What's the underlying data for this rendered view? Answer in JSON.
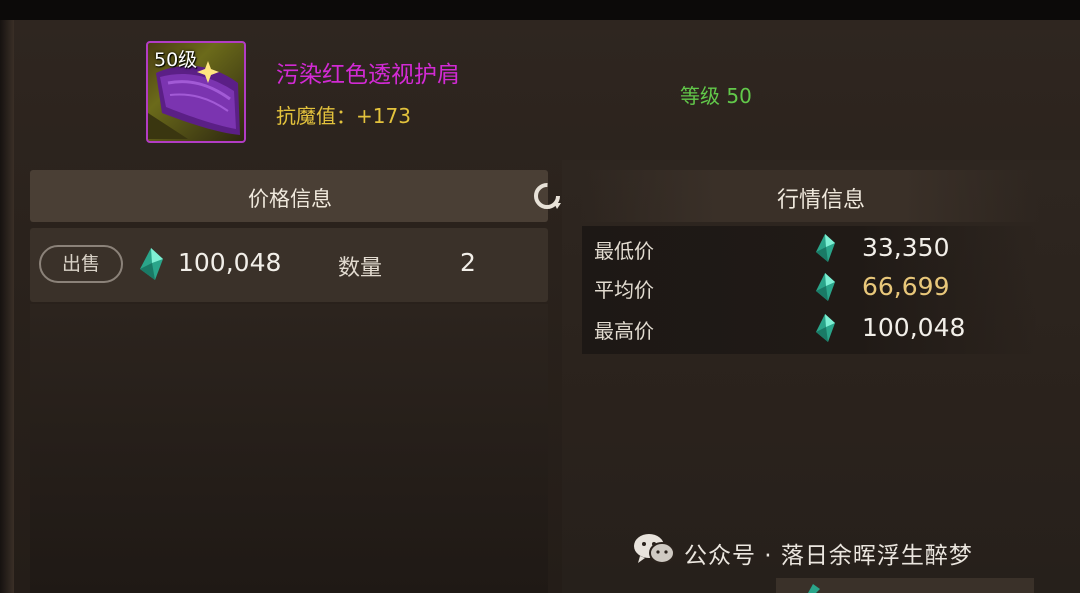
{
  "item": {
    "level_badge": "50级",
    "name": "污染红色透视护肩",
    "stat": "抗魔值：+173",
    "grade": "等级 50",
    "icon": "purple-shoulder-armor-icon"
  },
  "price_panel": {
    "title": "价格信息",
    "refresh_icon": "refresh-icon",
    "listing": {
      "sell_label": "出售",
      "currency_icon": "crystal-gem-icon",
      "price": "100,048",
      "quantity_label": "数量",
      "quantity": "2"
    }
  },
  "market_panel": {
    "title": "行情信息",
    "rows": [
      {
        "label": "最低价",
        "value": "33,350",
        "icon": "crystal-gem-icon"
      },
      {
        "label": "平均价",
        "value": "66,699",
        "icon": "crystal-gem-icon"
      },
      {
        "label": "最高价",
        "value": "100,048",
        "icon": "crystal-gem-icon"
      }
    ]
  },
  "watermark": {
    "text": "公众号 · 落日余晖浮生醉梦",
    "icon": "wechat-icon"
  },
  "colors": {
    "item_name": "#d22ad4",
    "stat": "#e3c23c",
    "grade": "#62c94a",
    "average_price": "#e8c77a",
    "gem": "#3fd0b0"
  }
}
